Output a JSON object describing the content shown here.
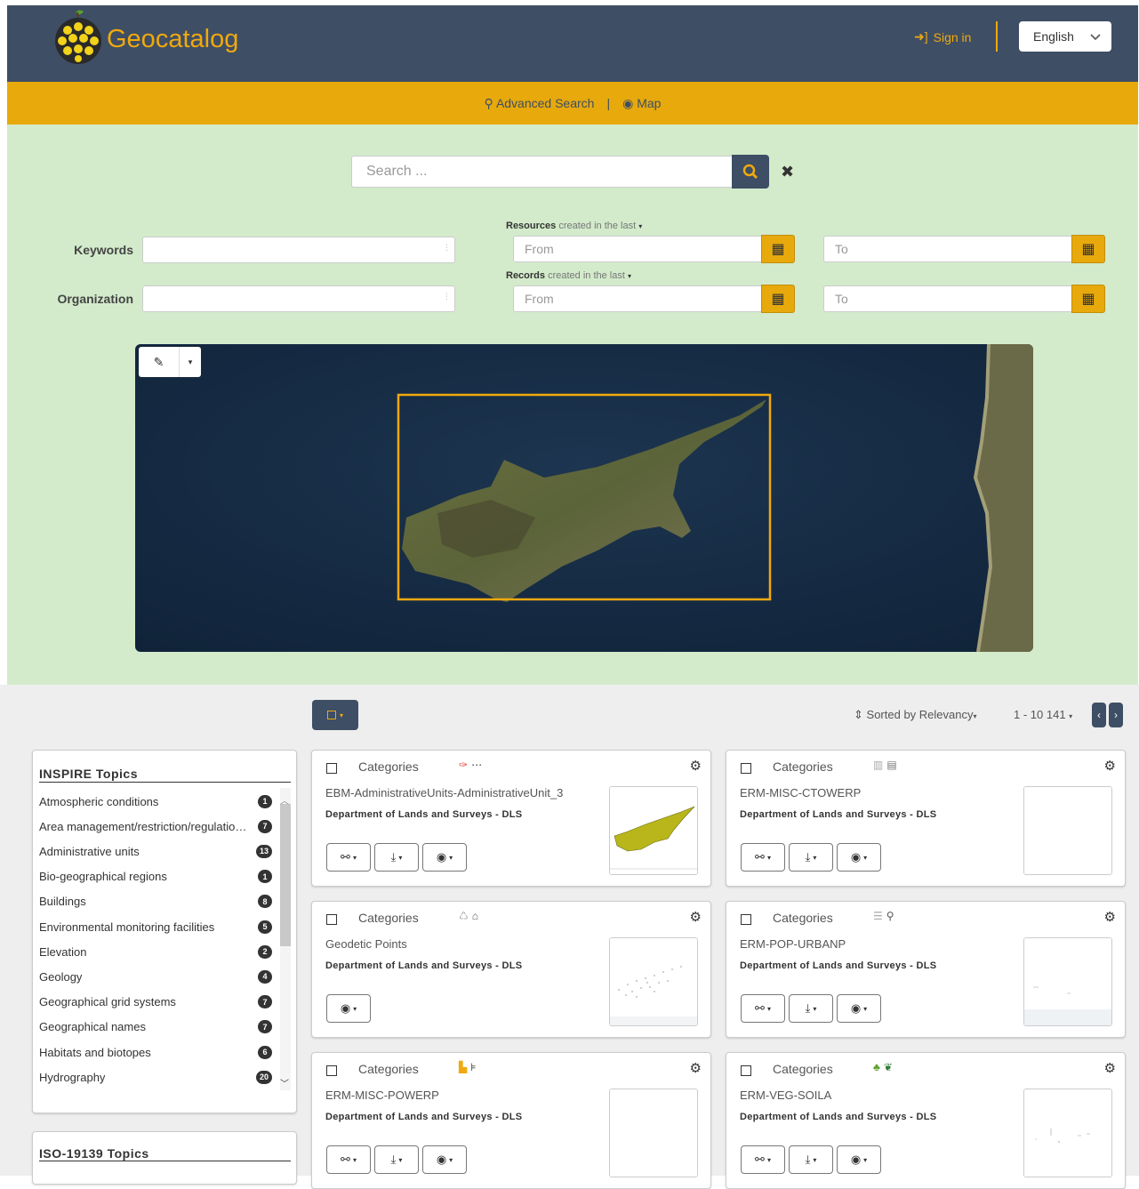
{
  "header": {
    "app_title": "Geocatalog",
    "sign_in_label": "Sign in",
    "language": "English",
    "colors": {
      "header_bg": "#3e4e64",
      "accent": "#e7a90c",
      "search_panel_bg": "#d3ebcb"
    }
  },
  "subnav": {
    "advanced_search_label": "Advanced Search",
    "separator": "|",
    "map_label": "Map"
  },
  "search": {
    "placeholder": "Search ...",
    "keywords_label": "Keywords",
    "organization_label": "Organization",
    "resources_label_bold": "Resources",
    "resources_label_rest": "created in the last",
    "records_label_bold": "Records",
    "records_label_rest": "created in the last",
    "from_placeholder": "From",
    "to_placeholder": "To"
  },
  "results_toolbar": {
    "sort_label": "Sorted by Relevancy",
    "paging_label": "1 - 10 141"
  },
  "facets": {
    "inspire": {
      "title": "INSPIRE Topics",
      "items": [
        {
          "label": "Atmospheric conditions",
          "count": "1"
        },
        {
          "label": "Area management/restriction/regulation zones",
          "count": "7"
        },
        {
          "label": "Administrative units",
          "count": "13"
        },
        {
          "label": "Bio-geographical regions",
          "count": "1"
        },
        {
          "label": "Buildings",
          "count": "8"
        },
        {
          "label": "Environmental monitoring facilities",
          "count": "5"
        },
        {
          "label": "Elevation",
          "count": "2"
        },
        {
          "label": "Geology",
          "count": "4"
        },
        {
          "label": "Geographical grid systems",
          "count": "7"
        },
        {
          "label": "Geographical names",
          "count": "7"
        },
        {
          "label": "Habitats and biotopes",
          "count": "6"
        },
        {
          "label": "Hydrography",
          "count": "20"
        }
      ]
    },
    "iso": {
      "title": "ISO-19139 Topics"
    }
  },
  "records": [
    {
      "categories_label": "Categories",
      "title": "EBM-AdministrativeUnits-AdministrativeUnit_3",
      "org": "Department of Lands and Surveys - DLS",
      "icons": [
        "admin-units-icon",
        "ellipsis-icon"
      ]
    },
    {
      "categories_label": "Categories",
      "title": "ERM-MISC-CTOWERP",
      "org": "Department of Lands and Surveys - DLS",
      "icons": [
        "industry-icon",
        "building-icon"
      ]
    },
    {
      "categories_label": "Categories",
      "title": "Geodetic Points",
      "org": "Department of Lands and Surveys - DLS",
      "icons": [
        "recycle-icon",
        "home-icon"
      ]
    },
    {
      "categories_label": "Categories",
      "title": "ERM-POP-URBANP",
      "org": "Department of Lands and Surveys - DLS",
      "icons": [
        "list-icon",
        "map-marker-icon"
      ]
    },
    {
      "categories_label": "Categories",
      "title": "ERM-MISC-POWERP",
      "org": "Department of Lands and Surveys - DLS",
      "icons": [
        "factory-icon",
        "cart-icon"
      ]
    },
    {
      "categories_label": "Categories",
      "title": "ERM-VEG-SOILA",
      "org": "Department of Lands and Surveys - DLS",
      "icons": [
        "tree-icon",
        "leaf-icon"
      ]
    }
  ]
}
